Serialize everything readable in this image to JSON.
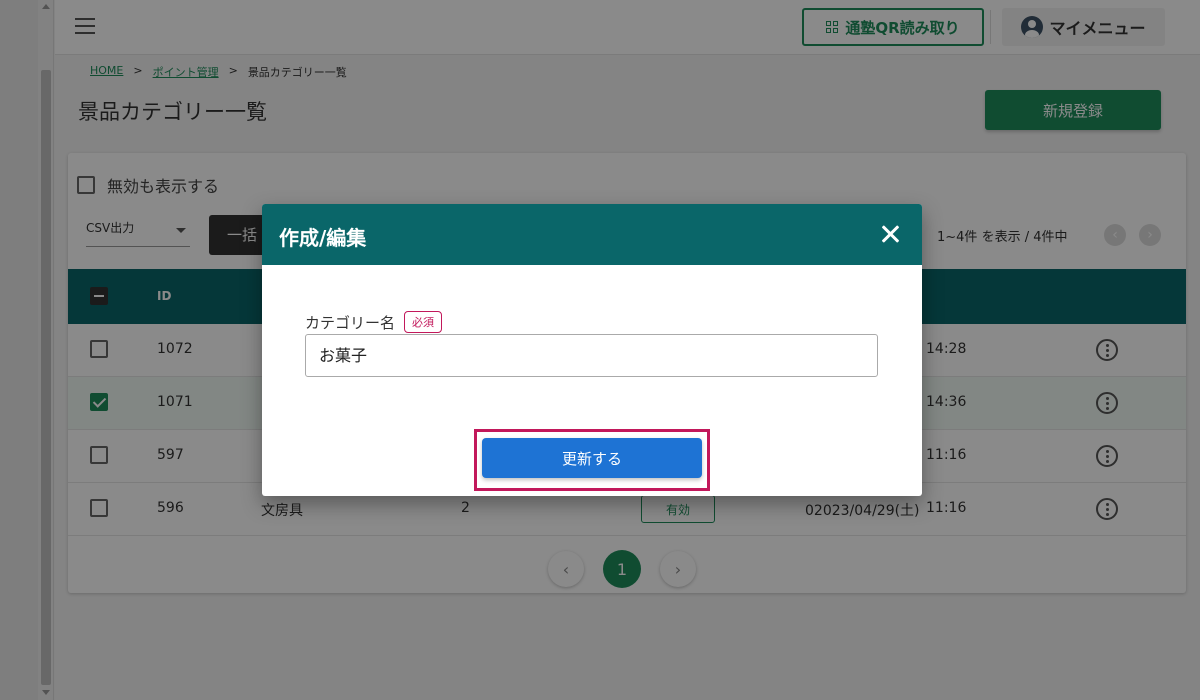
{
  "header": {
    "qr_label": "通塾QR読み取り",
    "mymenu_label": "マイメニュー"
  },
  "breadcrumb": {
    "home": "HOME",
    "sep1": ">",
    "points": "ポイント管理",
    "sep2": ">",
    "current": "景品カテゴリー一覧"
  },
  "page": {
    "title": "景品カテゴリー一覧",
    "new_button": "新規登録"
  },
  "toolbar": {
    "show_inactive_label": "無効も表示する",
    "csv_label": "CSV出力",
    "bulk_label": "一括",
    "page_info": "1~4件 を表示 / 4件中"
  },
  "table": {
    "headers": {
      "id": "ID"
    },
    "rows": [
      {
        "id": "1072",
        "name": "",
        "count": "",
        "status": "",
        "date": "",
        "time": "14:28",
        "checked": false
      },
      {
        "id": "1071",
        "name": "",
        "count": "",
        "status": "",
        "date": "",
        "time": "14:36",
        "checked": true
      },
      {
        "id": "597",
        "name": "",
        "count": "",
        "status": "",
        "date": "",
        "time": "11:16",
        "checked": false
      },
      {
        "id": "596",
        "name": "文房具",
        "count": "2",
        "status": "有効",
        "date": "02023/04/29(土)",
        "time": "11:16",
        "checked": false
      }
    ]
  },
  "pagination": {
    "prev": "‹",
    "current": "1",
    "next": "›"
  },
  "modal": {
    "title": "作成/編集",
    "field_label": "カテゴリー名",
    "required_badge": "必須",
    "field_value": "お菓子",
    "update_button": "更新する"
  },
  "colors": {
    "brand_green": "#1e8c5c",
    "header_teal": "#0a6669",
    "primary_blue": "#1e73d4",
    "highlight_magenta": "#c2185b"
  }
}
